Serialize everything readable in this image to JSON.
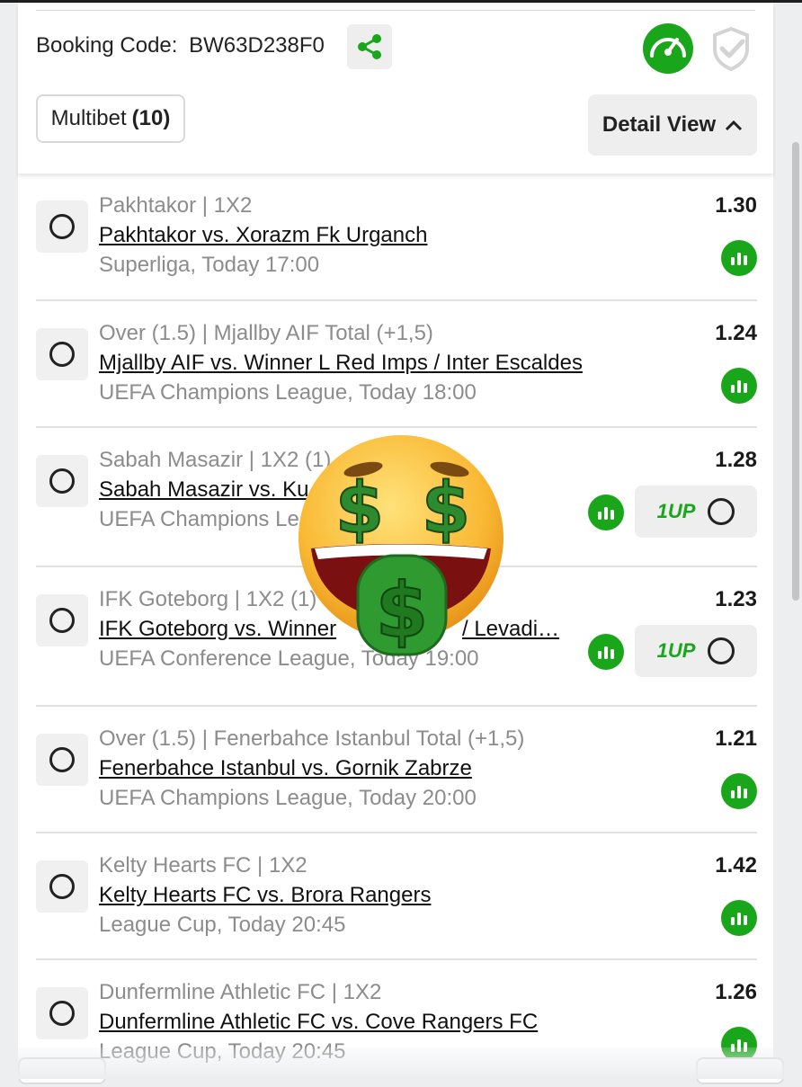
{
  "header": {
    "booking_label": "Booking Code:",
    "booking_code": "BW63D238F0",
    "multibet_label": "Multibet",
    "multibet_count": "(10)",
    "detail_view_label": "Detail View"
  },
  "bets": [
    {
      "market": "Pakhtakor | 1X2",
      "match": "Pakhtakor vs. Xorazm Fk Urganch",
      "info": "Superliga, Today 17:00",
      "odds": "1.30",
      "one_up": false
    },
    {
      "market": "Over (1.5) | Mjallby AIF Total (+1,5)",
      "match": "Mjallby AIF vs. Winner L Red Imps / Inter Escaldes",
      "info": "UEFA Champions League, Today 18:00",
      "odds": "1.24",
      "one_up": false
    },
    {
      "market": "Sabah Masazir | 1X2 (1)",
      "match": "Sabah Masazir vs. Ku",
      "info": "UEFA Champions Le",
      "odds": "1.28",
      "one_up": true,
      "one_up_label": "1UP"
    },
    {
      "market": "IFK Goteborg | 1X2 (1)",
      "match": "IFK Goteborg vs. Winner",
      "match_tail": "/ Levadi…",
      "info": "UEFA Conference League, Today 19:00",
      "odds": "1.23",
      "one_up": true,
      "one_up_label": "1UP"
    },
    {
      "market": "Over (1.5) | Fenerbahce Istanbul Total (+1,5)",
      "match": "Fenerbahce Istanbul vs. Gornik Zabrze",
      "info": "UEFA Champions League, Today 20:00",
      "odds": "1.21",
      "one_up": false
    },
    {
      "market": "Kelty Hearts FC | 1X2",
      "match": "Kelty Hearts FC vs. Brora Rangers",
      "info": "League Cup, Today 20:45",
      "odds": "1.42",
      "one_up": false
    },
    {
      "market": "Dunfermline Athletic FC | 1X2",
      "match": "Dunfermline Athletic FC vs. Cove Rangers FC",
      "info": "League Cup, Today 20:45",
      "odds": "1.26",
      "one_up": false
    }
  ],
  "colors": {
    "accent_green": "#1aa61a"
  },
  "overlay": {
    "emoji": "money-mouth-face"
  }
}
